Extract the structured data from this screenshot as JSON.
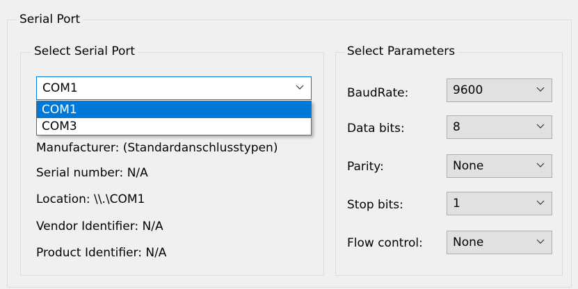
{
  "serial_port": {
    "title": "Serial Port"
  },
  "select_port": {
    "title": "Select Serial Port",
    "selected": "COM1",
    "options": [
      "COM1",
      "COM3"
    ],
    "info": {
      "manufacturer": "Manufacturer: (Standardanschlusstypen)",
      "serial_number": "Serial number: N/A",
      "location": "Location: \\\\.\\COM1",
      "vendor_id": "Vendor Identifier: N/A",
      "product_id": "Product Identifier: N/A"
    }
  },
  "parameters": {
    "title": "Select Parameters",
    "baud_rate": {
      "label": "BaudRate:",
      "value": "9600"
    },
    "data_bits": {
      "label": "Data bits:",
      "value": "8"
    },
    "parity": {
      "label": "Parity:",
      "value": "None"
    },
    "stop_bits": {
      "label": "Stop bits:",
      "value": "1"
    },
    "flow_control": {
      "label": "Flow control:",
      "value": "None"
    }
  },
  "icons": {
    "dropdown_arrow": "chevron-down-icon"
  },
  "colors": {
    "selection": "#0078d7",
    "focus_border": "#0078d7"
  }
}
